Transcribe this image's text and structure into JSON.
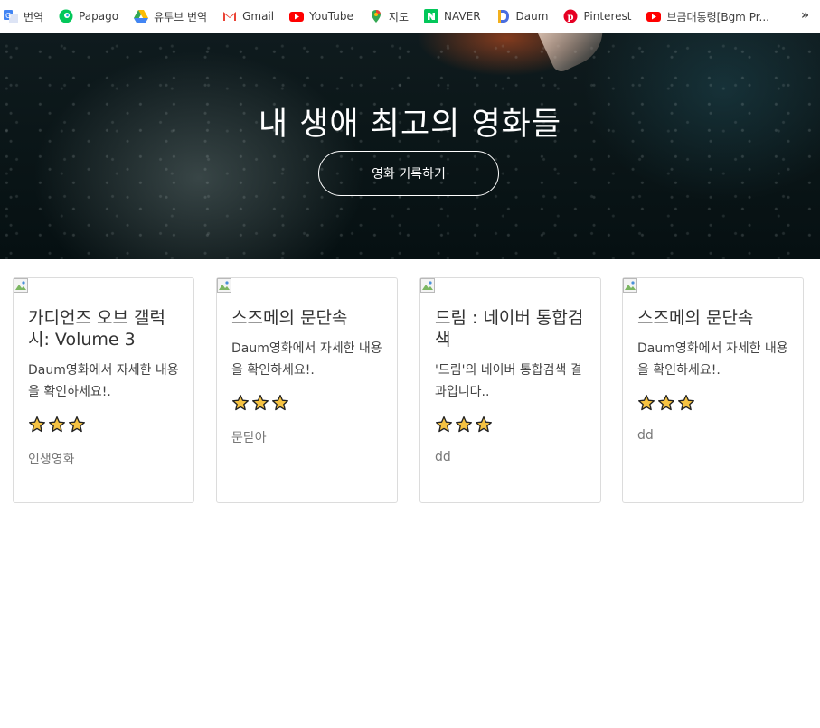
{
  "bookmarks": [
    {
      "label": "번역",
      "icon": "google-translate-icon",
      "color": "#4285f4"
    },
    {
      "label": "Papago",
      "icon": "papago-icon",
      "color": "#03c75a"
    },
    {
      "label": "유투브 번역",
      "icon": "google-drive-icon",
      "color": "#fbbc04"
    },
    {
      "label": "Gmail",
      "icon": "gmail-icon",
      "color": "#ea4335"
    },
    {
      "label": "YouTube",
      "icon": "youtube-icon",
      "color": "#ff0000"
    },
    {
      "label": "지도",
      "icon": "google-maps-icon",
      "color": "#34a853"
    },
    {
      "label": "NAVER",
      "icon": "naver-icon",
      "color": "#03c75a"
    },
    {
      "label": "Daum",
      "icon": "daum-icon",
      "color": "#4a6ee0"
    },
    {
      "label": "Pinterest",
      "icon": "pinterest-icon",
      "color": "#e60023"
    },
    {
      "label": "브금대통령[Bgm Pr...",
      "icon": "youtube-icon",
      "color": "#ff0000"
    }
  ],
  "more_label": "»",
  "hero": {
    "title": "내 생애 최고의 영화들",
    "button_label": "영화 기록하기"
  },
  "cards": [
    {
      "title": "가디언즈 오브 갤럭시: Volume 3",
      "desc": "Daum영화에서 자세한 내용을 확인하세요!.",
      "stars": 3,
      "memo": "인생영화"
    },
    {
      "title": "스즈메의 문단속",
      "desc": "Daum영화에서 자세한 내용을 확인하세요!.",
      "stars": 3,
      "memo": "문닫아"
    },
    {
      "title": "드림 : 네이버 통합검색",
      "desc": "'드림'의 네이버 통합검색 결과입니다..",
      "stars": 3,
      "memo": "dd"
    },
    {
      "title": "스즈메의 문단속",
      "desc": "Daum영화에서 자세한 내용을 확인하세요!.",
      "stars": 3,
      "memo": "dd"
    }
  ],
  "colors": {
    "star_fill": "#f6c342",
    "star_stroke": "#222222"
  }
}
